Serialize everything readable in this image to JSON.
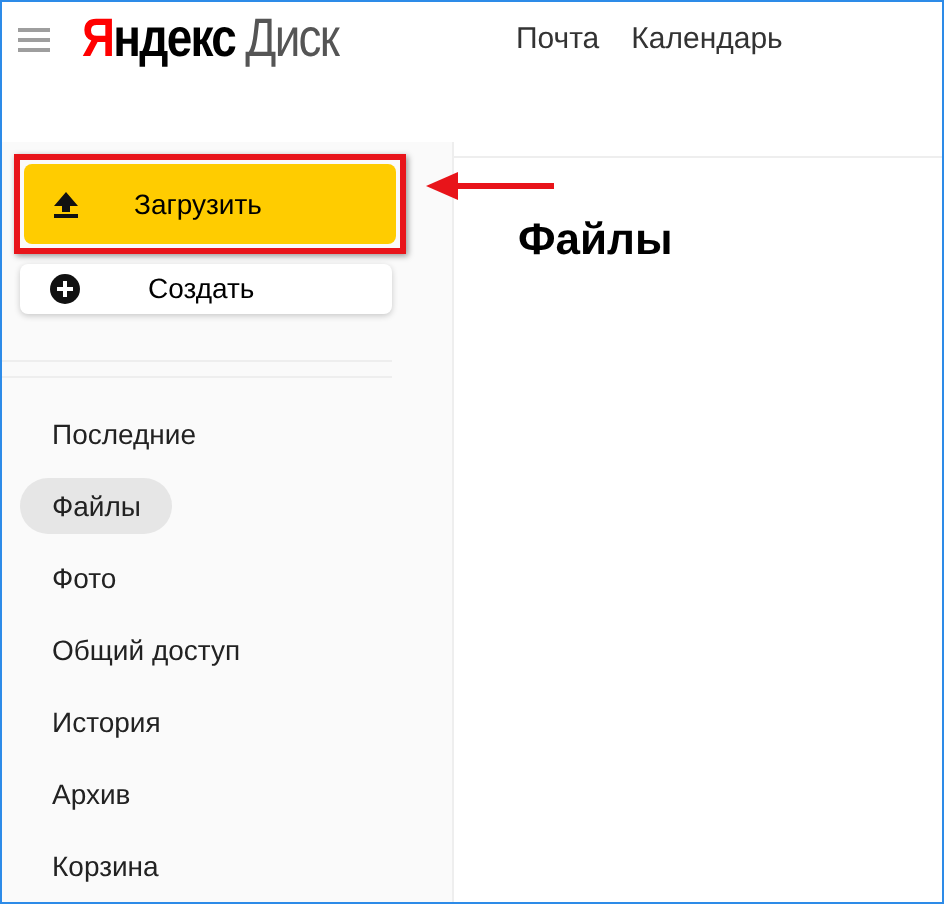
{
  "header": {
    "logo": {
      "brand": "Яндекс",
      "product": "Диск"
    },
    "links": [
      "Почта",
      "Календарь"
    ]
  },
  "sidebar": {
    "upload_button": {
      "label": "Загрузить",
      "highlighted": true
    },
    "create_button": {
      "label": "Создать"
    },
    "items": [
      {
        "label": "Последние",
        "selected": false
      },
      {
        "label": "Файлы",
        "selected": true
      },
      {
        "label": "Фото",
        "selected": false
      },
      {
        "label": "Общий доступ",
        "selected": false
      },
      {
        "label": "История",
        "selected": false
      },
      {
        "label": "Архив",
        "selected": false
      },
      {
        "label": "Корзина",
        "selected": false
      }
    ]
  },
  "main": {
    "title": "Файлы"
  }
}
